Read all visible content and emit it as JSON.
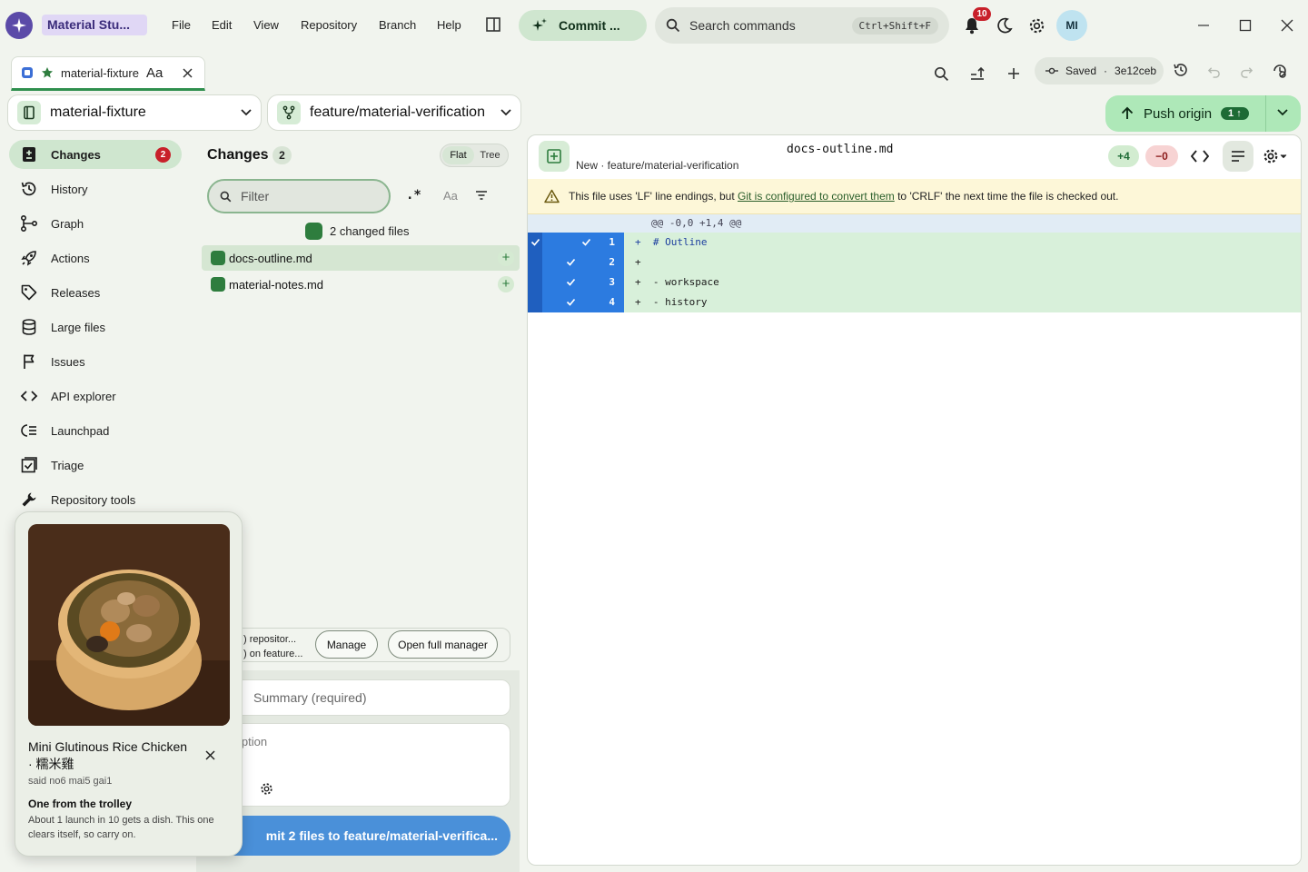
{
  "app": {
    "title": "Material Stu..."
  },
  "menu": [
    "File",
    "Edit",
    "View",
    "Repository",
    "Branch",
    "Help"
  ],
  "commit_action": {
    "label": "Commit ..."
  },
  "search": {
    "placeholder": "Search commands",
    "shortcut": "Ctrl+Shift+F"
  },
  "notifications": {
    "count": "10"
  },
  "user": {
    "initials": "MI"
  },
  "repo_tab": {
    "name": "material-fixture",
    "font_toggle": "Aa"
  },
  "saved": {
    "label": "Saved",
    "separator": "·",
    "hash": "3e12ceb"
  },
  "repo_selector": {
    "name": "material-fixture"
  },
  "branch_selector": {
    "name": "feature/material-verification"
  },
  "push": {
    "label": "Push origin",
    "count": "1"
  },
  "sidebar": {
    "items": [
      {
        "label": "Changes",
        "badge": "2",
        "icon": "changes-icon"
      },
      {
        "label": "History",
        "icon": "history-icon"
      },
      {
        "label": "Graph",
        "icon": "graph-icon"
      },
      {
        "label": "Actions",
        "icon": "rocket-icon"
      },
      {
        "label": "Releases",
        "icon": "tag-icon"
      },
      {
        "label": "Large files",
        "icon": "database-icon"
      },
      {
        "label": "Issues",
        "icon": "flag-icon"
      },
      {
        "label": "API explorer",
        "icon": "code-icon"
      },
      {
        "label": "Launchpad",
        "icon": "list-icon"
      },
      {
        "label": "Triage",
        "icon": "checkbox-icon"
      },
      {
        "label": "Repository tools",
        "icon": "wrench-icon"
      }
    ]
  },
  "changes": {
    "title": "Changes",
    "count": "2",
    "view_flat": "Flat",
    "view_tree": "Tree",
    "filter_placeholder": "Filter",
    "regex_toggle": ".*",
    "case_toggle": "Aa",
    "summary": "2 changed files",
    "files": [
      {
        "name": "docs-outline.md",
        "selected": true
      },
      {
        "name": "material-notes.md",
        "selected": false
      }
    ],
    "lfs_line1": ") repositor...",
    "lfs_line2": ") on feature...",
    "manage_label": "Manage",
    "open_manager_label": "Open full manager",
    "summary_placeholder": "Summary (required)",
    "description_placeholder": "iption",
    "commit_button": "mit 2 files to feature/material-verifica..."
  },
  "diff": {
    "file": "docs-outline.md",
    "subtitle": "New · feature/material-verification",
    "additions": "+4",
    "deletions": "−0",
    "warning_pre": "This file uses 'LF' line endings, but ",
    "warning_link": "Git is configured to convert them",
    "warning_post": " to 'CRLF' the next time the file is checked out.",
    "hunk": "@@ -0,0 +1,4 @@",
    "lines": [
      {
        "num": "1",
        "code": "+  # Outline"
      },
      {
        "num": "2",
        "code": "+"
      },
      {
        "num": "3",
        "code": "+  - workspace"
      },
      {
        "num": "4",
        "code": "+  - history"
      }
    ]
  },
  "toast": {
    "title": "Mini Glutinous Rice Chicken · 糯米雞",
    "romanization": "said no6 mai5 gai1",
    "heading": "One from the trolley",
    "body": "About 1 launch in 10 gets a dish. This one clears itself, so carry on."
  }
}
